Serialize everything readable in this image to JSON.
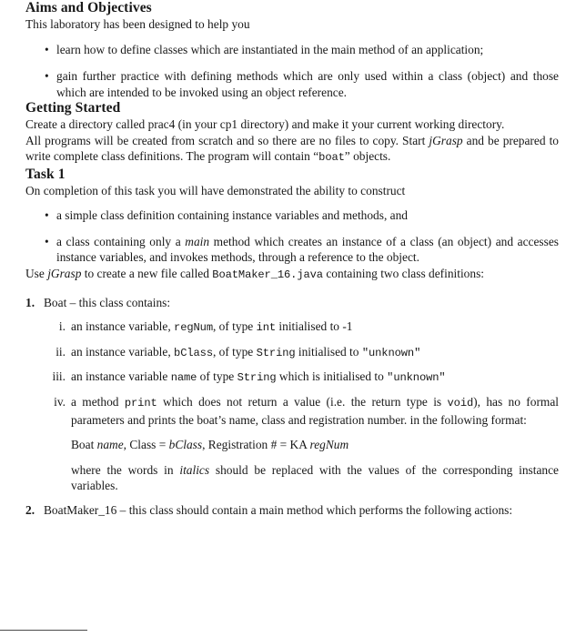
{
  "document": {
    "sections": [
      {
        "id": "aims",
        "heading": "Aims and Objectives",
        "intro": "This laboratory has been designed to help you",
        "bullets": [
          "learn how to define classes which are instantiated in the main method of an application;",
          "gain further practice with defining methods which are only used within a class (object) and those which are intended to be invoked using an object reference."
        ]
      },
      {
        "id": "getting-started",
        "heading": "Getting Started",
        "paragraphs": [
          {
            "id": "create-directory",
            "prefix": "Create a directory called prac4 (in your cp1 directory) and make it your current working directory."
          },
          {
            "id": "all-programs",
            "part1": "All programs will be created from scratch and so there are no files to copy. Start ",
            "italic1": "jGrasp",
            "part2": " and be prepared to write complete class definitions. The program will contain “",
            "code1": "boat",
            "part3": "” objects."
          }
        ]
      },
      {
        "id": "task-1",
        "heading": "Task 1",
        "intro": "On completion of this task you will have demonstrated the ability to construct",
        "bullets": [
          {
            "text": "a simple class definition containing instance variables and methods, and"
          },
          {
            "part1": "a class containing only a ",
            "italic1": "main",
            "part2": " method which creates an instance of a class (an object) and accesses instance variables, and invokes methods, through a reference to the object."
          }
        ],
        "use_jgrasp": {
          "part1": "Use ",
          "italic1": "jGrasp",
          "part2": " to create a new file called ",
          "code1": "BoatMaker_16.java",
          "part3": " containing two class definitions:"
        },
        "numbered_items": [
          {
            "marker": "1.",
            "text": "Boat – this class contains:",
            "roman_items": [
              {
                "marker": "i.",
                "part1": "an instance variable, ",
                "code1": "regNum",
                "part2": ", of type ",
                "code2": "int",
                "part3": " initialised to -1"
              },
              {
                "marker": "ii.",
                "part1": "an instance variable, ",
                "code1": "bClass",
                "part2": ", of type ",
                "code2": "String",
                "part3": " initialised to ",
                "code3": "\"unknown\""
              },
              {
                "marker": "iii.",
                "part1": "an instance variable ",
                "code1": "name",
                "part2": " of type ",
                "code2": "String",
                "part3": " which is initialised to ",
                "code3": "\"unknown\""
              },
              {
                "marker": "iv.",
                "part1": "a method ",
                "code1": "print",
                "part2": " which does not return a value (i.e. the return type is ",
                "code2": "void",
                "part3": "), has no formal parameters and prints the boat’s name, class and registration number. in the following format:",
                "format_line": {
                  "text1": "Boat ",
                  "italic1": "name",
                  "text2": ", Class = ",
                  "italic2": "bClass",
                  "text3": ", Registration # = KA ",
                  "italic3": "regNum"
                },
                "note": {
                  "part1": "where the words in ",
                  "italic1": "italics",
                  "part2": " should be replaced with the values of the corresponding instance variables."
                }
              }
            ]
          },
          {
            "marker": "2.",
            "text": "BoatMaker_16 – this class should contain a main method which performs the following actions:"
          }
        ]
      }
    ]
  }
}
